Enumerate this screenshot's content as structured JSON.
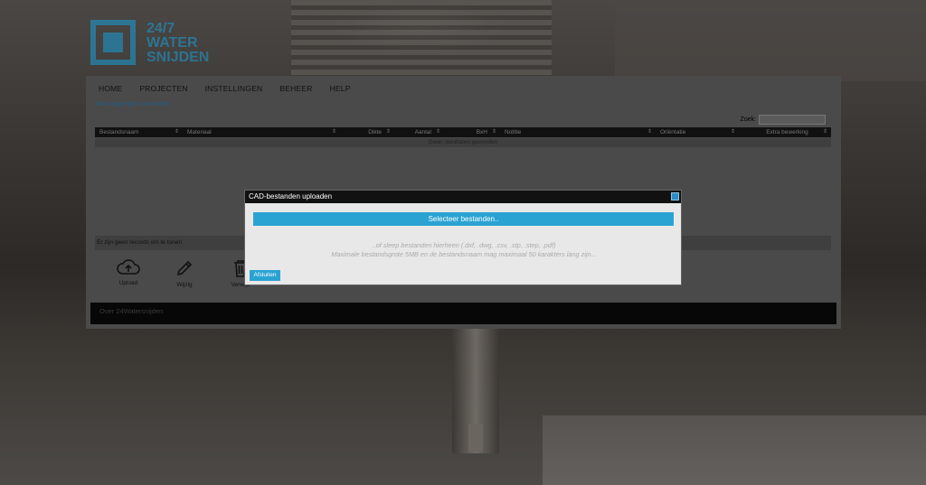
{
  "logo": {
    "line1": "24/7",
    "line2": "WATER",
    "line3": "SNIJDEN"
  },
  "nav": [
    "HOME",
    "PROJECTEN",
    "INSTELLINGEN",
    "BEHEER",
    "HELP"
  ],
  "breadcrumb": "Aanvraagregels aanmaken",
  "search": {
    "label": "Zoek:",
    "value": ""
  },
  "table": {
    "columns": [
      "Bestandsnaam",
      "Materiaal",
      "Dikte",
      "Aantal",
      "BxH",
      "Notitie",
      "Oriëntatie",
      "Extra bewerking"
    ],
    "empty_text": "Geen resultaten gevonden"
  },
  "status": "Er zijn geen records om te tonen",
  "tools": {
    "upload": "Upload",
    "edit": "Wijzig",
    "delete": "Verwijd"
  },
  "footer": "Over 24Watersnijden",
  "modal": {
    "title": "CAD-bestanden uploaden",
    "select_button": "Selecteer bestanden..",
    "hint1": "..of sleep bestanden hierheen (.dxf, .dwg, .csv, .stp, .step, .pdf)",
    "hint2": "Maximale bestandsgrote 5MB en de bestandsnaam mag maximaal 50 karakters lang zijn...",
    "close_button": "Afsluiten"
  },
  "colors": {
    "accent": "#2aa3d3",
    "modal_header": "#111111",
    "logo": "#1a9ed8"
  }
}
